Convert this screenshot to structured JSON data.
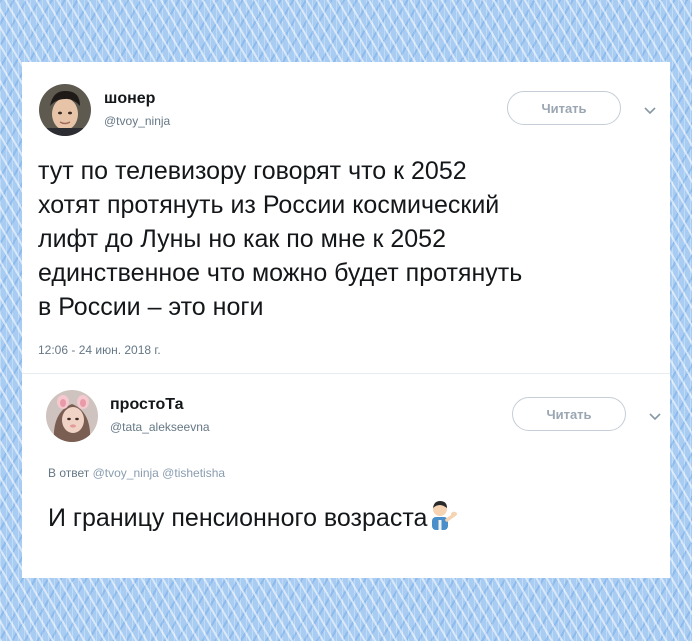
{
  "tweet1": {
    "display_name": "шонер",
    "handle": "@tvoy_ninja",
    "follow_label": "Читать",
    "text_lines": [
      "тут по телевизору говорят что к 2052",
      "хотят протянуть из России космический",
      "лифт до Луны но как по мне к 2052",
      "единственное что можно будет протянуть",
      "в России – это ноги"
    ],
    "timestamp": "12:06 - 24 июн. 2018 г."
  },
  "tweet2": {
    "display_name": "простоТа",
    "handle": "@tata_alekseevna",
    "follow_label": "Читать",
    "reply_prefix": "В ответ",
    "reply_handle_1": "@tvoy_ninja",
    "reply_handle_2": "@tishetisha",
    "text": "И границу пенсионного возраста",
    "emoji": "man-tipping-hand-emoji"
  },
  "colors": {
    "background": "#a9cdf2",
    "card": "#ffffff",
    "text": "#14171a",
    "muted": "#657786",
    "border": "#c5ced6"
  }
}
